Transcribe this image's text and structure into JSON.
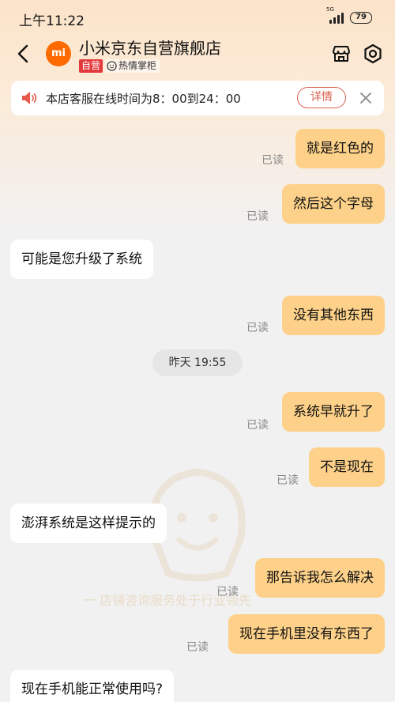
{
  "status_bar": {
    "time": "上午11:22",
    "network": "5G",
    "battery": "79"
  },
  "header": {
    "store_name": "小米京东自营旗舰店",
    "logo_text": "mi",
    "self_operated_badge": "自营",
    "hot_badge": "热情掌柜"
  },
  "notice": {
    "text": "本店客服在线时间为8：00到24：00",
    "button": "详情"
  },
  "messages": [
    {
      "text": "就是红色的",
      "side": "out",
      "status": "已读"
    },
    {
      "text": "然后这个字母",
      "side": "out",
      "status": "已读"
    },
    {
      "text": "可能是您升级了系统",
      "side": "in"
    },
    {
      "text": "没有其他东西",
      "side": "out",
      "status": "已读"
    },
    {
      "text": "系统早就升了",
      "side": "out",
      "status": "已读"
    },
    {
      "text": "不是现在",
      "side": "out",
      "status": "已读"
    },
    {
      "text": "澎湃系统是这样提示的",
      "side": "in"
    },
    {
      "text": "那告诉我怎么解决",
      "side": "out",
      "status": "已读"
    },
    {
      "text": "现在手机里没有东西了",
      "side": "out",
      "status": "已读"
    },
    {
      "text": "现在手机能正常使用吗?",
      "side": "in"
    }
  ],
  "timestamp": "昨天 19:55",
  "watermark": "一 店铺咨询服务处于行业领先",
  "colors": {
    "accent": "#fdd189",
    "brand": "#ff6a00",
    "notice_button": "#d9604d",
    "badge": "#e4393c"
  }
}
